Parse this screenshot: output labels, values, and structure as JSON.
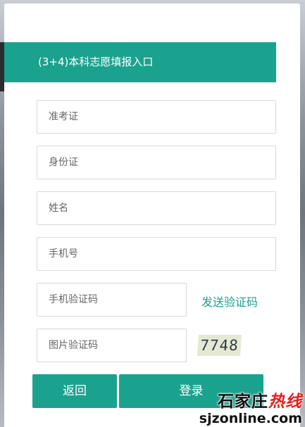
{
  "banner": {
    "title": "(3+4)本科志愿填报入口"
  },
  "form": {
    "exam_id_placeholder": "准考证",
    "id_card_placeholder": "身份证",
    "name_placeholder": "姓名",
    "phone_placeholder": "手机号",
    "sms_code_placeholder": "手机验证码",
    "send_code_label": "发送验证码",
    "image_code_placeholder": "图片验证码",
    "captcha_text": "7748"
  },
  "buttons": {
    "back_label": "返回",
    "login_label": "登录"
  },
  "watermark": {
    "brand_part1": "石家庄",
    "brand_part2": "热线",
    "url": "sjzonline.com"
  },
  "colors": {
    "accent": "#1ba28f",
    "watermark_red": "#e0201a"
  }
}
